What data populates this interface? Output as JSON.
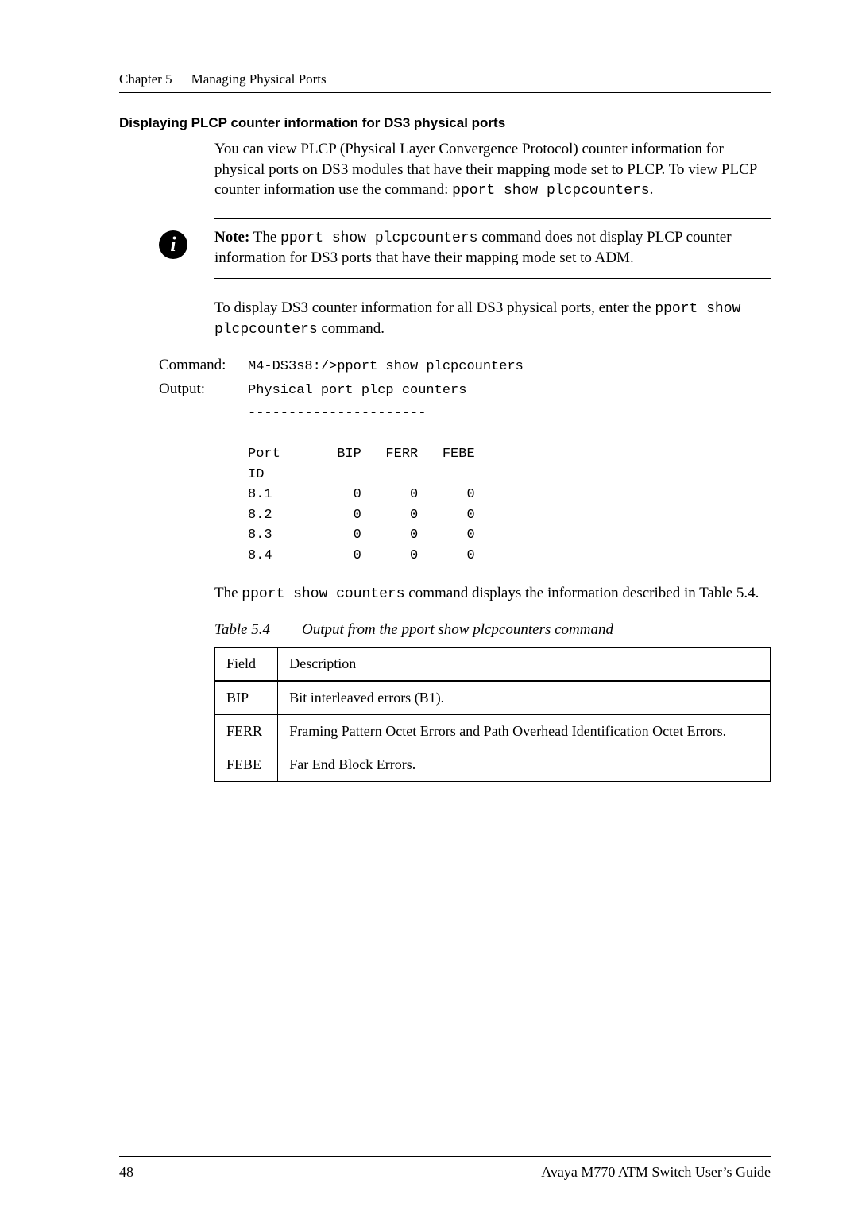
{
  "header": {
    "chapter": "Chapter 5",
    "title": "Managing Physical Ports"
  },
  "section": {
    "title": "Displaying PLCP counter information for DS3 physical ports",
    "para1_pre": "You can view PLCP (Physical Layer Convergence Protocol) counter information for physical ports on DS3 modules that have their mapping mode set to PLCP. To view PLCP counter information use the command: ",
    "para1_code": "pport show plcpcounters",
    "para1_post": "."
  },
  "note": {
    "icon": "i",
    "label": "Note:",
    "pre": " The ",
    "code": "pport show plcpcounters",
    "mid": " command does not display PLCP counter information for DS3 ports that have their mapping mode set to ADM."
  },
  "para2_pre": "To display DS3 counter information for all DS3 physical ports, enter the ",
  "para2_code": "pport show plcpcounters",
  "para2_post": " command.",
  "cmd": {
    "label_command": "Command:",
    "command_line": "M4-DS3s8:/>pport show plcpcounters",
    "label_output": "Output:",
    "output_header": "Physical port plcp counters",
    "output_div": "----------------------",
    "col_port": "Port",
    "col_id": "ID",
    "col_bip": "BIP",
    "col_ferr": "FERR",
    "col_febe": "FEBE",
    "rows": [
      {
        "id": "8.1",
        "bip": "0",
        "ferr": "0",
        "febe": "0"
      },
      {
        "id": "8.2",
        "bip": "0",
        "ferr": "0",
        "febe": "0"
      },
      {
        "id": "8.3",
        "bip": "0",
        "ferr": "0",
        "febe": "0"
      },
      {
        "id": "8.4",
        "bip": "0",
        "ferr": "0",
        "febe": "0"
      }
    ]
  },
  "para3_pre": "The ",
  "para3_code": "pport show counters",
  "para3_mid": " command displays the information described in ",
  "para3_ref": "Table 5.4",
  "para3_post": ".",
  "table_caption": {
    "number": "Table 5.4",
    "text": "Output from the pport show plcpcounters command"
  },
  "table": {
    "h_field": "Field",
    "h_desc": "Description",
    "rows": [
      {
        "field": "BIP",
        "desc": "Bit interleaved errors (B1)."
      },
      {
        "field": "FERR",
        "desc": "Framing Pattern Octet Errors and Path Overhead Identification Octet Errors."
      },
      {
        "field": "FEBE",
        "desc": "Far End Block Errors."
      }
    ]
  },
  "footer": {
    "page": "48",
    "guide": "Avaya M770 ATM Switch User’s Guide"
  }
}
